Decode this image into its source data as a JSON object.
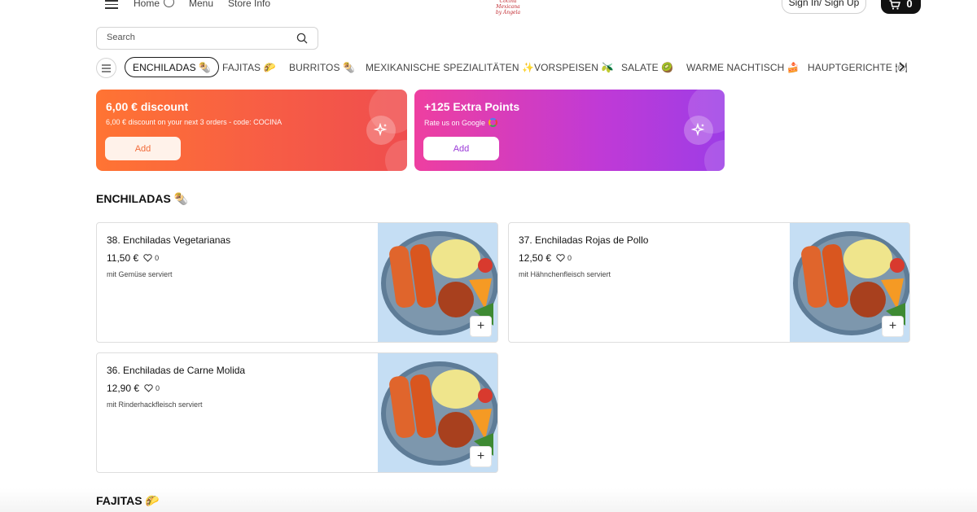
{
  "header": {
    "nav": {
      "home": "Home",
      "menu": "Menu",
      "store_info": "Store Info"
    },
    "logo_line1": "Cocina Mexicana",
    "logo_line2": "by Ángela",
    "sign_in_label": "Sign In/ Sign Up",
    "cart_count": "0"
  },
  "search": {
    "placeholder": "Search"
  },
  "categories": [
    {
      "label": "ENCHILADAS 🌯",
      "active": true
    },
    {
      "label": "FAJITAS 🌮"
    },
    {
      "label": "BURRITOS 🌯"
    },
    {
      "label": "MEXIKANISCHE SPEZIALITÄTEN ✨"
    },
    {
      "label": "VORSPEISEN 🫒"
    },
    {
      "label": "SALATE 🥝"
    },
    {
      "label": "WARME NACHTISCH 🍰"
    },
    {
      "label": "HAUPTGERICHTE 🍽"
    }
  ],
  "promos": [
    {
      "title": "6,00 € discount",
      "subtitle": "6,00 € discount on your next 3 orders - code: COCINA",
      "button": "Add",
      "theme": "#f26b3a"
    },
    {
      "title": "+125 Extra Points",
      "subtitle": "Rate us on Google",
      "button": "Add",
      "theme": "#9b3ad8"
    }
  ],
  "sections": [
    {
      "title": "ENCHILADAS 🌯",
      "items": [
        {
          "name": "38. Enchiladas Vegetarianas",
          "price": "11,50 €",
          "likes": "0",
          "description": "mit Gemüse serviert"
        },
        {
          "name": "37. Enchiladas Rojas de Pollo",
          "price": "12,50 €",
          "likes": "0",
          "description": "mit Hähnchenfleisch serviert"
        },
        {
          "name": "36. Enchiladas de Carne Molida",
          "price": "12,90 €",
          "likes": "0",
          "description": "mit Rinderhackfleisch serviert"
        }
      ]
    },
    {
      "title": "FAJITAS 🌮",
      "items": []
    }
  ],
  "icons": {
    "menu": "hamburger-icon",
    "home_info": "clock-icon",
    "cart": "cart-icon",
    "search": "search-icon",
    "next": "chevron-right-icon",
    "promo_badge": "sparkle-icon",
    "like": "heart-icon",
    "add": "plus-icon"
  }
}
